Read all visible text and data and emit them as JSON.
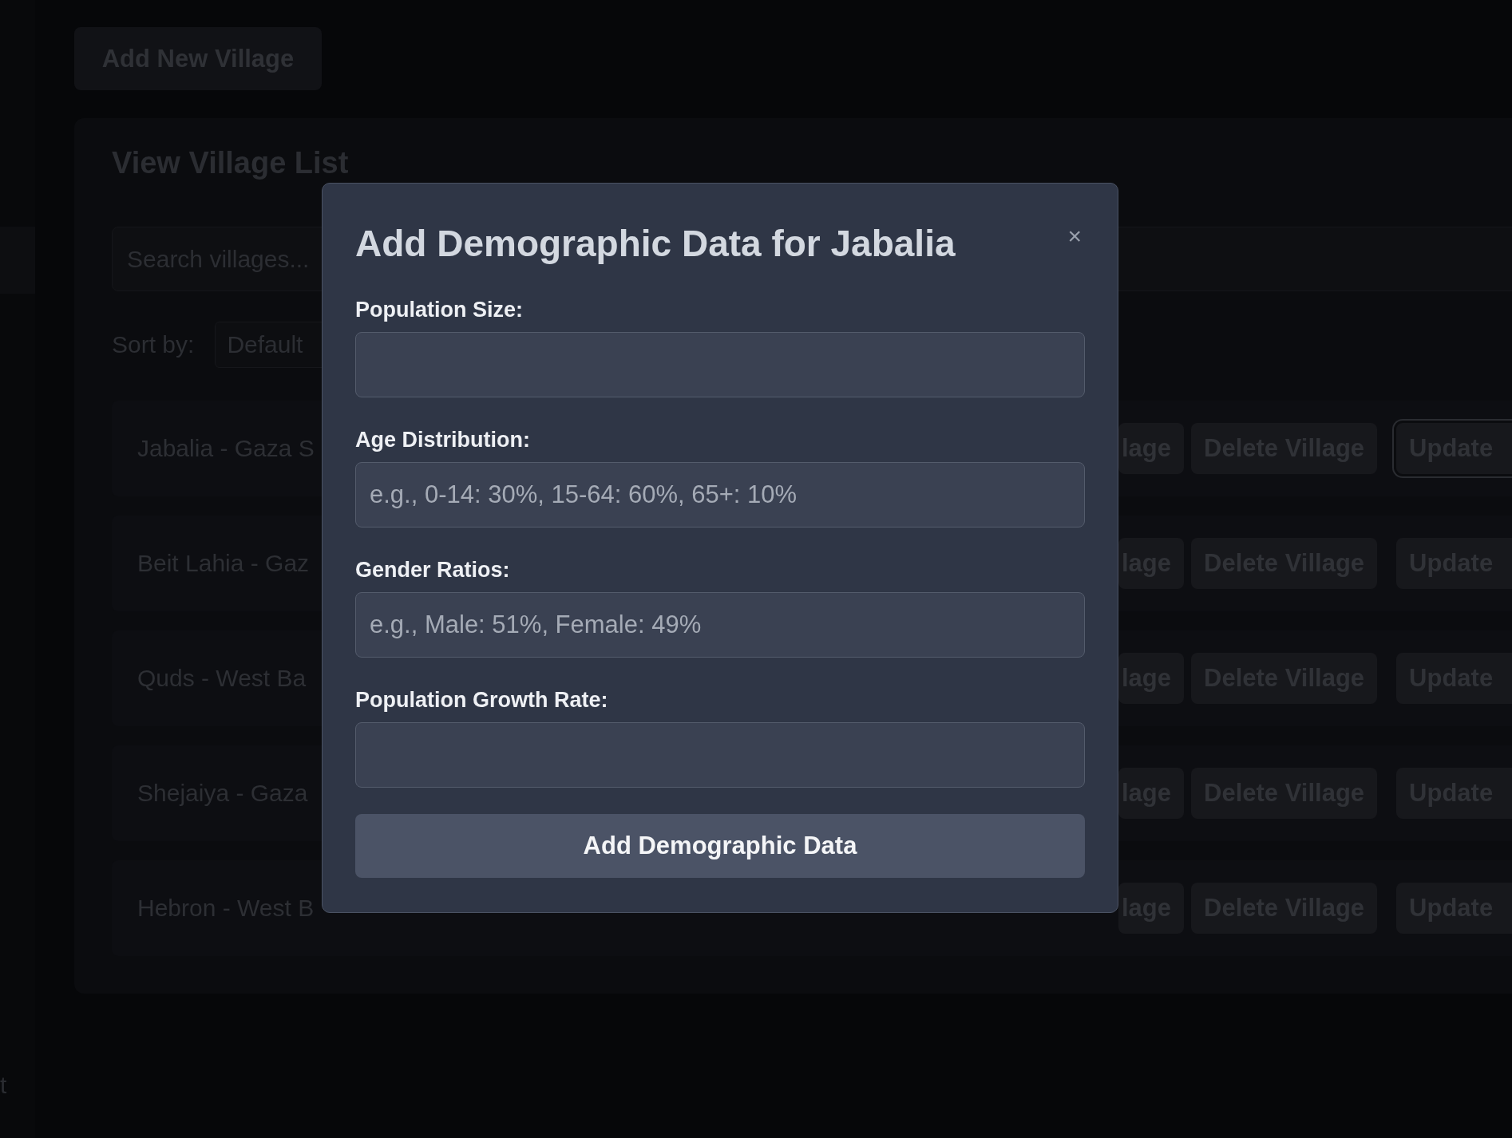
{
  "sidebar": {
    "footer_item": "t"
  },
  "add_button": "Add New Village",
  "panel": {
    "title": "View Village List",
    "search": {
      "placeholder": "Search villages..."
    },
    "sort": {
      "label": "Sort by:",
      "value": "Default"
    },
    "rows": [
      {
        "name": "Jabalia - Gaza S",
        "actions": [
          {
            "label": "lage",
            "outlined": false
          },
          {
            "label": "Delete Village",
            "outlined": false
          },
          {
            "label": "Update",
            "outlined": true
          }
        ]
      },
      {
        "name": "Beit Lahia - Gaz",
        "actions": [
          {
            "label": "lage",
            "outlined": false
          },
          {
            "label": "Delete Village",
            "outlined": false
          },
          {
            "label": "Update",
            "outlined": false
          }
        ]
      },
      {
        "name": "Quds - West Ba",
        "actions": [
          {
            "label": "lage",
            "outlined": false
          },
          {
            "label": "Delete Village",
            "outlined": false
          },
          {
            "label": "Update",
            "outlined": false
          }
        ]
      },
      {
        "name": "Shejaiya - Gaza",
        "actions": [
          {
            "label": "lage",
            "outlined": false
          },
          {
            "label": "Delete Village",
            "outlined": false
          },
          {
            "label": "Update",
            "outlined": false
          }
        ]
      },
      {
        "name": "Hebron - West B",
        "actions": [
          {
            "label": "lage",
            "outlined": false
          },
          {
            "label": "Delete Village",
            "outlined": false
          },
          {
            "label": "Update",
            "outlined": false
          }
        ]
      }
    ]
  },
  "modal": {
    "title": "Add Demographic Data for Jabalia",
    "close": "×",
    "fields": [
      {
        "label": "Population Size:"
      },
      {
        "label": "Age Distribution:",
        "placeholder": "e.g., 0-14: 30%, 15-64: 60%, 65+: 10%"
      },
      {
        "label": "Gender Ratios:",
        "placeholder": "e.g., Male: 51%, Female: 49%"
      },
      {
        "label": "Population Growth Rate:"
      }
    ],
    "submit": "Add Demographic Data"
  }
}
